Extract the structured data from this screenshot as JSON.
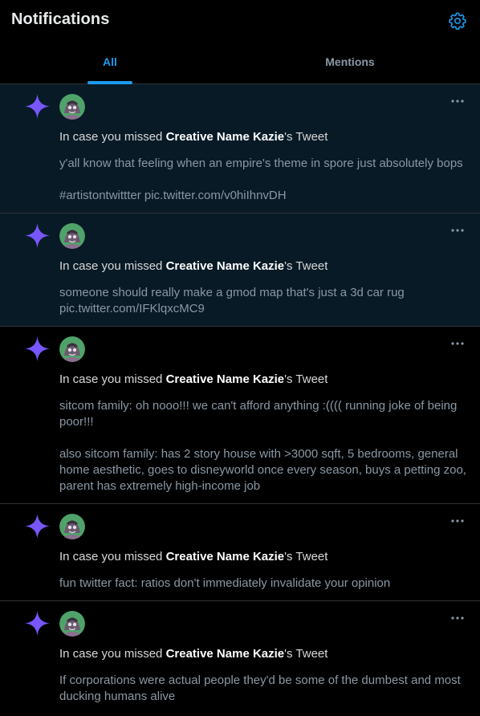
{
  "header": {
    "title": "Notifications",
    "settings_icon": "gear-icon"
  },
  "tabs": [
    {
      "label": "All",
      "active": true
    },
    {
      "label": "Mentions",
      "active": false
    }
  ],
  "colors": {
    "accent": "#1d9bf0",
    "star": "#7856ff",
    "unread_bg": "#081a26"
  },
  "notifications": [
    {
      "unread": true,
      "prefix": "In case you missed ",
      "author": "Creative Name Kazie",
      "suffix": "'s Tweet",
      "body": [
        "y'all know that feeling when an empire's theme in spore just absolutely bops",
        "#artistontwittter pic.twitter.com/v0hiIhnvDH"
      ]
    },
    {
      "unread": true,
      "prefix": "In case you missed ",
      "author": "Creative Name Kazie",
      "suffix": "'s Tweet",
      "body": [
        "someone should really make a gmod map that's just a 3d car rug pic.twitter.com/IFKlqxcMC9"
      ]
    },
    {
      "unread": false,
      "prefix": "In case you missed ",
      "author": "Creative Name Kazie",
      "suffix": "'s Tweet",
      "body": [
        "sitcom family: oh nooo!!! we can't afford anything :(((( running joke of being poor!!!",
        "also sitcom family: has 2 story house with >3000 sqft, 5 bedrooms, general home aesthetic, goes to disneyworld once every season, buys a petting zoo, parent has extremely high-income job"
      ]
    },
    {
      "unread": false,
      "prefix": "In case you missed ",
      "author": "Creative Name Kazie",
      "suffix": "'s Tweet",
      "body": [
        "fun twitter fact: ratios don't immediately invalidate your opinion"
      ]
    },
    {
      "unread": false,
      "prefix": "In case you missed ",
      "author": "Creative Name Kazie",
      "suffix": "'s Tweet",
      "body": [
        "If corporations were actual people they'd be some of the dumbest and most ducking humans alive"
      ]
    }
  ]
}
